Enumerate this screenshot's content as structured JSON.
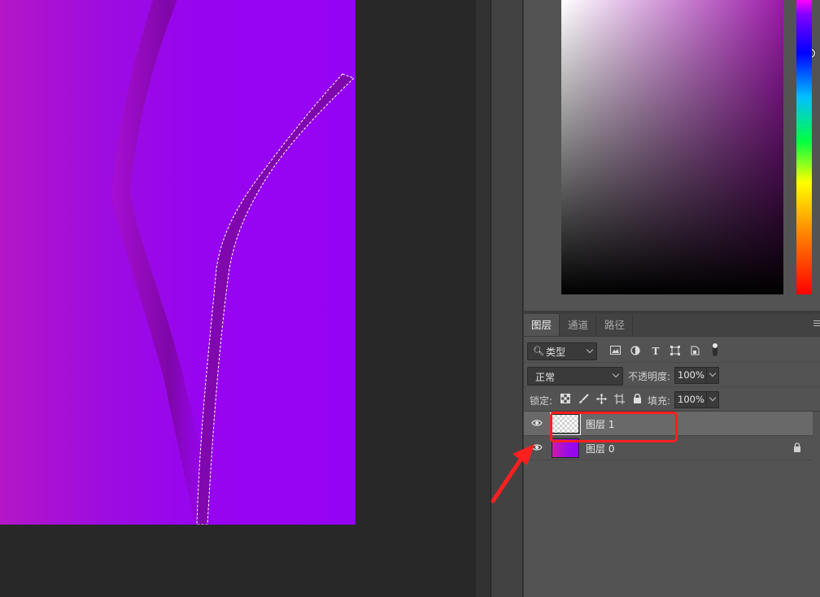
{
  "layers_panel": {
    "tabs": [
      {
        "label": "图层",
        "active": true
      },
      {
        "label": "通道",
        "active": false
      },
      {
        "label": "路径",
        "active": false
      }
    ],
    "filter": {
      "kind_label": "类型",
      "icons": [
        "image-filter-icon",
        "adjustment-filter-icon",
        "type-filter-icon",
        "shape-filter-icon",
        "smart-object-filter-icon"
      ]
    },
    "blend_mode": "正常",
    "opacity_label": "不透明度:",
    "opacity_value": "100%",
    "lock_label": "锁定:",
    "fill_label": "填充:",
    "fill_value": "100%",
    "layers": [
      {
        "name": "图层 1",
        "visible": true,
        "selected": true,
        "locked": false
      },
      {
        "name": "图层 0",
        "visible": true,
        "selected": false,
        "locked": true
      }
    ]
  },
  "color_picker": {
    "base_hue": "#9a1aa8",
    "hue_position": 0.0
  },
  "annotation": {
    "color": "#ff1f1f"
  }
}
